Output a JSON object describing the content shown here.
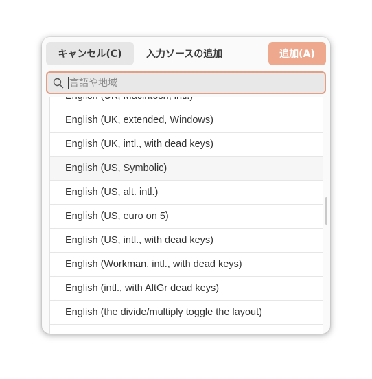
{
  "dialog": {
    "title": "入力ソースの追加",
    "cancel_label": "キャンセル(C)",
    "add_label": "追加(A)"
  },
  "search": {
    "placeholder": "言語や地域",
    "value": ""
  },
  "list": {
    "items": [
      {
        "label": "English (UK, Macintosh, intl.)"
      },
      {
        "label": "English (UK, extended, Windows)"
      },
      {
        "label": "English (UK, intl., with dead keys)"
      },
      {
        "label": "English (US, Symbolic)",
        "hovered": true
      },
      {
        "label": "English (US, alt. intl.)"
      },
      {
        "label": "English (US, euro on 5)"
      },
      {
        "label": "English (US, intl., with dead keys)"
      },
      {
        "label": "English (Workman, intl., with dead keys)"
      },
      {
        "label": "English (intl., with AltGr dead keys)"
      },
      {
        "label": "English (the divide/multiply toggle the layout)"
      },
      {
        "label": ""
      }
    ]
  },
  "colors": {
    "accent": "#eda88e",
    "focus_border": "#e49e83"
  }
}
